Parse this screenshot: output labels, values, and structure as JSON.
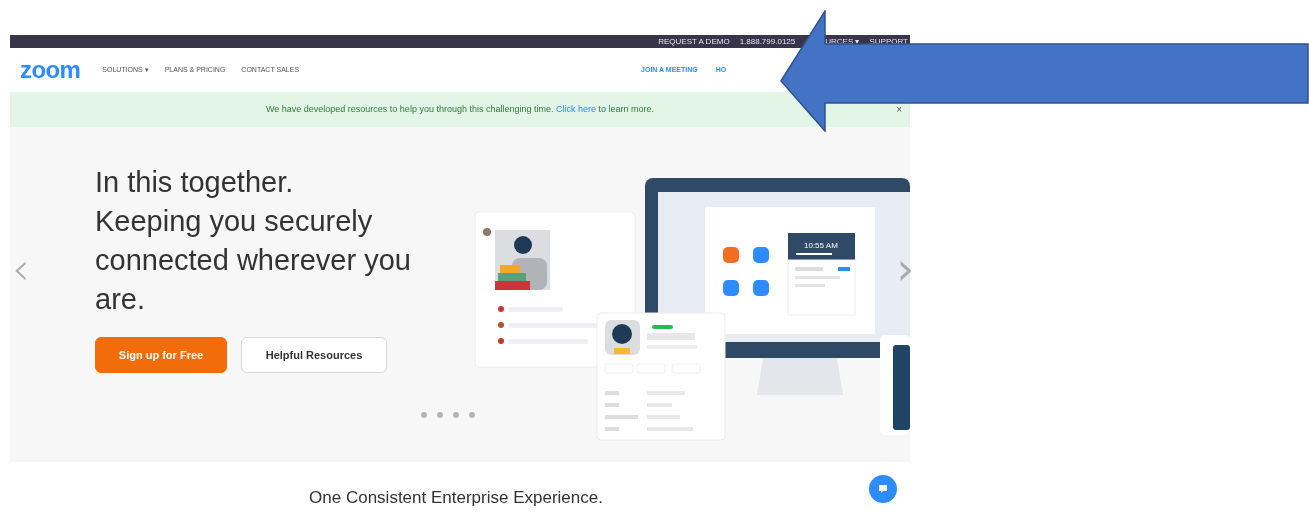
{
  "top_bar": {
    "links": [
      "REQUEST A DEMO",
      "1.888.799.0125",
      "URCES ▾",
      "SUPPORT"
    ]
  },
  "nav": {
    "logo": "zoom",
    "left_links": [
      "SOLUTIONS ▾",
      "PLANS & PRICING",
      "CONTACT SALES"
    ],
    "right_links": [
      "JOIN A MEETING",
      "HO"
    ]
  },
  "banner": {
    "text_before": "We have developed resources to help you through this challenging time.",
    "link": "Click here",
    "text_after": "to learn more.",
    "close": "×"
  },
  "hero": {
    "headline": [
      "In this together.",
      "Keeping you securely",
      "connected wherever you",
      "are."
    ],
    "buttons": [
      {
        "label": "Sign up for Free",
        "kind": "primary"
      },
      {
        "label": "Helpful Resources",
        "kind": "secondary"
      }
    ],
    "prev": "‹",
    "next": "›",
    "clock": "10:55 AM"
  },
  "section_title": "One Consistent Enterprise Experience."
}
